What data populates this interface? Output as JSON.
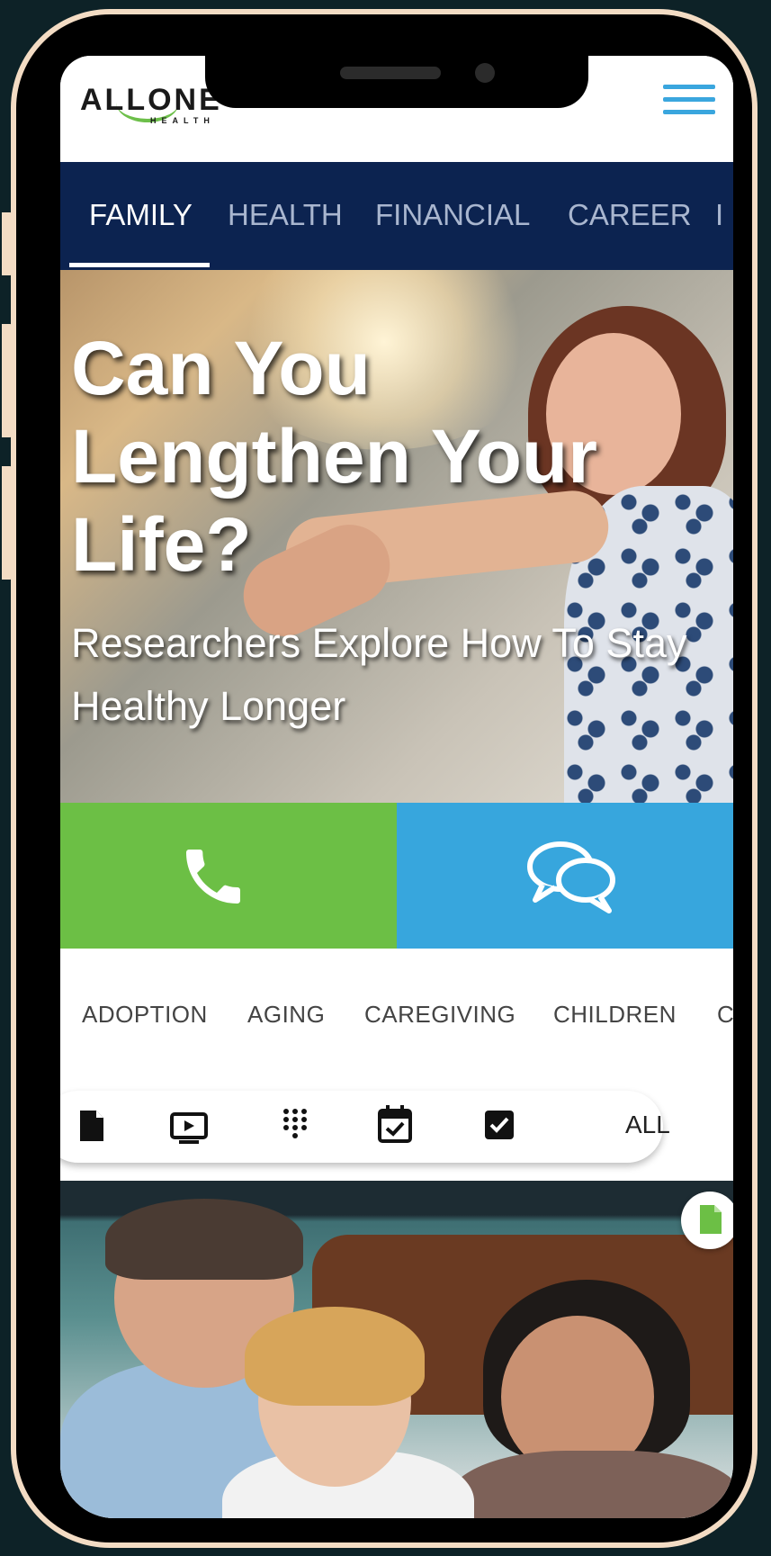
{
  "header": {
    "logo_text": "ALLONE",
    "logo_subtext": "HEALTH"
  },
  "nav": {
    "tabs": [
      {
        "label": "FAMILY",
        "active": true
      },
      {
        "label": "HEALTH",
        "active": false
      },
      {
        "label": "FINANCIAL",
        "active": false
      },
      {
        "label": "CAREER",
        "active": false
      },
      {
        "label": "I",
        "active": false
      }
    ]
  },
  "hero": {
    "title": "Can You Lengthen Your Life?",
    "subtitle": "Researchers Explore How To Stay Healthy Longer"
  },
  "actions": {
    "call_icon": "phone-icon",
    "chat_icon": "chat-bubbles-icon",
    "call_color": "#6cbf45",
    "chat_color": "#37a6dd"
  },
  "categories": [
    "ADOPTION",
    "AGING",
    "CAREGIVING",
    "CHILDREN",
    "C"
  ],
  "filters": {
    "icons": [
      "document-icon",
      "video-icon",
      "dialpad-icon",
      "calendar-check-icon",
      "checkbox-icon"
    ],
    "all_label": "ALL"
  },
  "colors": {
    "nav_bg": "#0c2350",
    "accent_blue": "#3aa6de",
    "accent_green": "#6cbf45"
  }
}
